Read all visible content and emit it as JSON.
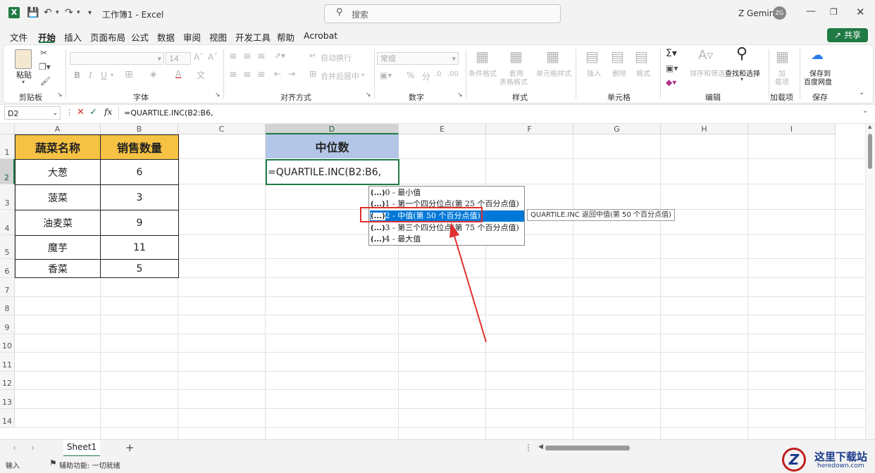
{
  "titlebar": {
    "title": "工作簿1 - Excel",
    "search_placeholder": "搜索",
    "user_name": "Z Gemini",
    "user_initials": "ZG"
  },
  "menu": [
    "文件",
    "开始",
    "插入",
    "页面布局",
    "公式",
    "数据",
    "审阅",
    "视图",
    "开发工具",
    "帮助",
    "Acrobat"
  ],
  "share_label": "共享",
  "ribbon": {
    "paste": "粘贴",
    "font_size": "14",
    "align_wrap": "自动换行",
    "align_merge": "合并后居中",
    "number_format": "常规",
    "cond_format": "条件格式",
    "table_format_1": "套用",
    "table_format_2": "表格格式",
    "cell_style": "单元格样式",
    "insert": "插入",
    "delete": "删除",
    "format": "格式",
    "sort_filter": "排序和筛选",
    "find_select": "查找和选择",
    "addins_1": "加",
    "addins_2": "载项",
    "save_1": "保存到",
    "save_2": "百度网盘",
    "groups": [
      "剪贴板",
      "字体",
      "对齐方式",
      "数字",
      "样式",
      "单元格",
      "编辑",
      "加载项",
      "保存"
    ]
  },
  "formula_bar": {
    "name_box": "D2",
    "formula": "=QUARTILE.INC(B2:B6,"
  },
  "columns": [
    "A",
    "B",
    "C",
    "D",
    "E",
    "F",
    "G",
    "H",
    "I"
  ],
  "rows": [
    "1",
    "2",
    "3",
    "4",
    "5",
    "6",
    "7",
    "8",
    "9",
    "10",
    "11",
    "12",
    "13",
    "14"
  ],
  "table": {
    "headers": [
      "蔬菜名称",
      "销售数量"
    ],
    "rows": [
      [
        "大葱",
        "6"
      ],
      [
        "菠菜",
        "3"
      ],
      [
        "油麦菜",
        "9"
      ],
      [
        "魔芋",
        "11"
      ],
      [
        "香菜",
        "5"
      ]
    ]
  },
  "d1": "中位数",
  "d2": "=QUARTILE.INC(B2:B6,",
  "dropdown": [
    {
      "prefix": "(...)",
      "text": "0 - 最小值"
    },
    {
      "prefix": "(...)",
      "text": "1 - 第一个四分位点(第 25 个百分点值)"
    },
    {
      "prefix": "(...)",
      "text": "2 - 中值(第 50 个百分点值)"
    },
    {
      "prefix": "(...)",
      "text": "3 - 第三个四分位点(第 75 个百分点值)"
    },
    {
      "prefix": "(...)",
      "text": "4 - 最大值"
    }
  ],
  "tooltip": "QUARTILE.INC 返回中值(第 50 个百分点值)",
  "sheet_tab": "Sheet1",
  "status": {
    "mode": "输入",
    "accessibility": "辅助功能: 一切就绪"
  },
  "watermark": {
    "line1": "这里下载站",
    "line2": "heredown.com"
  },
  "colors": {
    "excel_green": "#1f7a43",
    "header_yellow": "#f6c243",
    "header_blue": "#b4c6e7",
    "highlight": "#0078d7",
    "annotation_red": "#e03030"
  }
}
